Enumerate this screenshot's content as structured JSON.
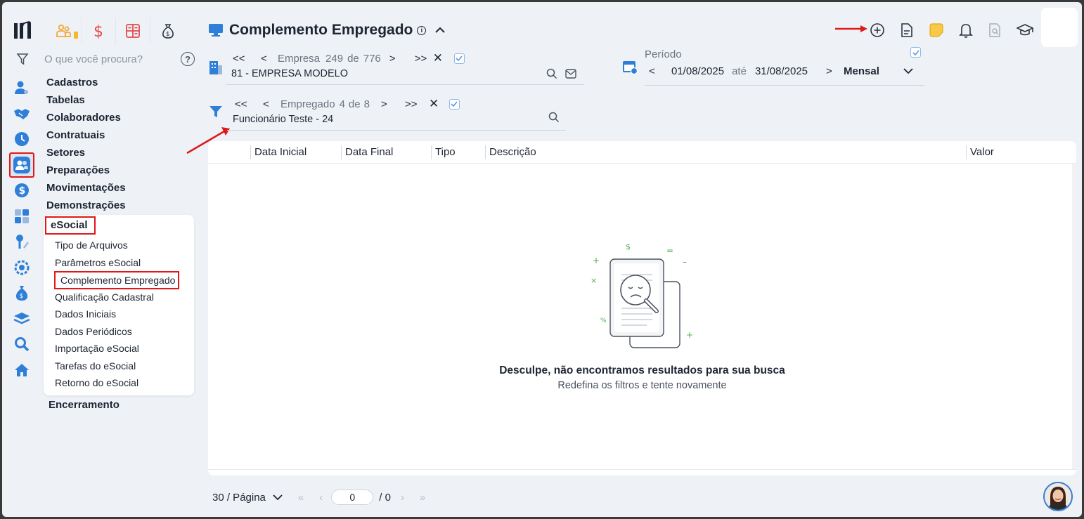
{
  "app": {
    "search_placeholder": "O que você procura?",
    "help_label": "?"
  },
  "menu": {
    "items": [
      "Cadastros",
      "Tabelas",
      "Colaboradores",
      "Contratuais",
      "Setores",
      "Preparações",
      "Movimentações",
      "Demonstrações"
    ],
    "esocial_header": "eSocial",
    "esocial_items": [
      "Tipo de Arquivos",
      "Parâmetros eSocial",
      "Complemento Empregado",
      "Qualificação Cadastral",
      "Dados Iniciais",
      "Dados Periódicos",
      "Importação eSocial",
      "Tarefas do eSocial",
      "Retorno do eSocial"
    ],
    "last_item": "Encerramento"
  },
  "header": {
    "title": "Complemento Empregado",
    "info_symbol": "i"
  },
  "empresa": {
    "label": "Empresa",
    "current": "249",
    "of": "de",
    "total": "776",
    "value": "81 - EMPRESA MODELO"
  },
  "empregado": {
    "label": "Empregado",
    "current": "4",
    "of": "de",
    "total": "8",
    "value": "Funcionário Teste - 24"
  },
  "periodo": {
    "label": "Período",
    "start": "01/08/2025",
    "sep": "até",
    "end": "31/08/2025",
    "mode": "Mensal"
  },
  "table": {
    "columns": [
      "Data Inicial",
      "Data Final",
      "Tipo",
      "Descrição",
      "Valor"
    ],
    "rows": [],
    "empty_title": "Desculpe, não encontramos resultados para sua busca",
    "empty_subtitle": "Redefina os filtros e tente novamente"
  },
  "pager": {
    "per_page": "30 / Página",
    "current_page": "0",
    "total_pages": "/ 0"
  },
  "colors": {
    "accent": "#2f7fd8",
    "highlight": "#e01818",
    "background": "#eef2f7"
  }
}
